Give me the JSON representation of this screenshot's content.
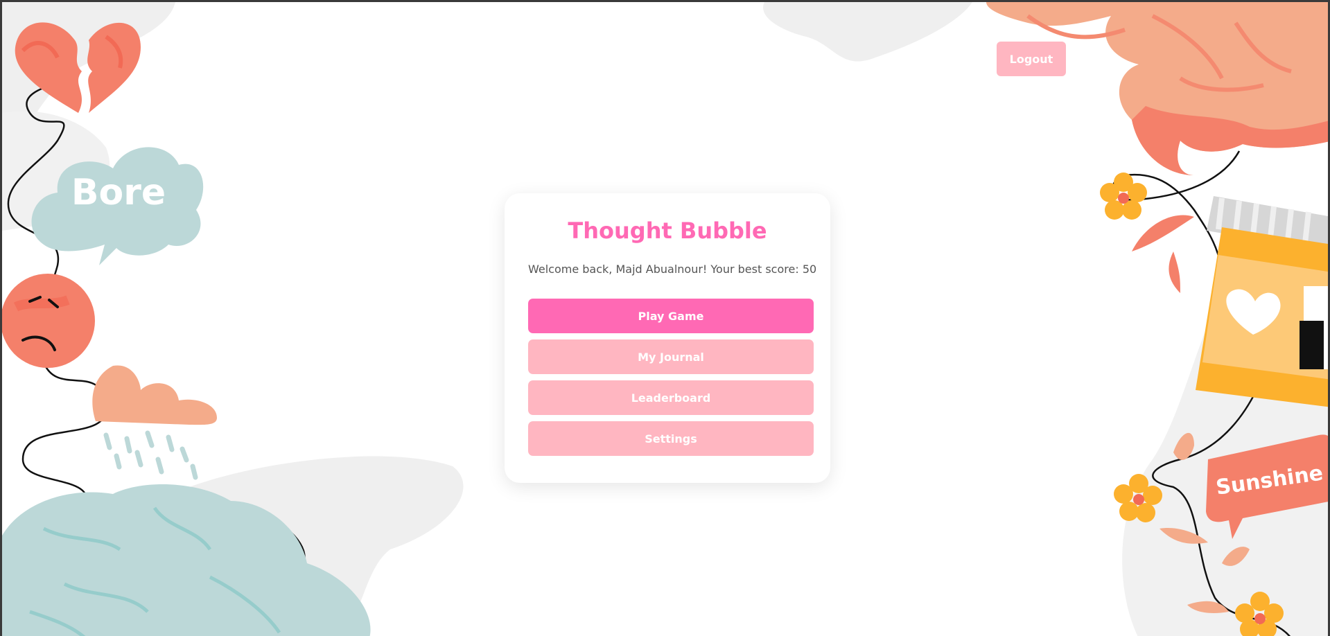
{
  "app": {
    "title": "Thought Bubble",
    "welcome_text": "Welcome back, Majd Abualnour! Your best score: 50"
  },
  "header": {
    "logout_label": "Logout"
  },
  "menu": {
    "items": [
      {
        "label": "Play Game",
        "primary": true
      },
      {
        "label": "My Journal",
        "primary": false
      },
      {
        "label": "Leaderboard",
        "primary": false
      },
      {
        "label": "Settings",
        "primary": false
      }
    ]
  },
  "decorations": {
    "bore_bubble_text": "Bore",
    "sunshine_bubble_text": "Sunshine"
  },
  "colors": {
    "accent_pink": "#ff69b4",
    "light_pink": "#ffb6c1",
    "coral": "#f4806a",
    "peach": "#f4ab8a",
    "teal_gray": "#bcd8d8",
    "yellow": "#fcb12e"
  }
}
